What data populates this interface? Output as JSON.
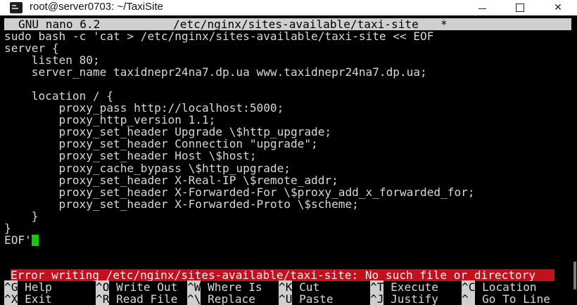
{
  "window": {
    "title": "root@server0703: ~/TaxiSite",
    "minimize_label": "",
    "maximize_label": "",
    "close_label": "✕"
  },
  "nano": {
    "version": "GNU nano 6.2",
    "filename": "/etc/nginx/sites-available/taxi-site",
    "modified": "*"
  },
  "code_lines": [
    "sudo bash -c 'cat > /etc/nginx/sites-available/taxi-site << EOF",
    "server {",
    "    listen 80;",
    "    server_name taxidnepr24na7.dp.ua www.taxidnepr24na7.dp.ua;",
    "",
    "    location / {",
    "        proxy_pass http://localhost:5000;",
    "        proxy_http_version 1.1;",
    "        proxy_set_header Upgrade \\$http_upgrade;",
    "        proxy_set_header Connection \"upgrade\";",
    "        proxy_set_header Host \\$host;",
    "        proxy_cache_bypass \\$http_upgrade;",
    "        proxy_set_header X-Real-IP \\$remote_addr;",
    "        proxy_set_header X-Forwarded-For \\$proxy_add_x_forwarded_for;",
    "        proxy_set_header X-Forwarded-Proto \\$scheme;",
    "    }",
    "}",
    "EOF'"
  ],
  "status": {
    "message": "Error writing /etc/nginx/sites-available/taxi-site: No such file or directory"
  },
  "shortcuts": {
    "row1": [
      {
        "key": "^G",
        "label": " Help"
      },
      {
        "key": "^O",
        "label": " Write Out"
      },
      {
        "key": "^W",
        "label": " Where Is"
      },
      {
        "key": "^K",
        "label": " Cut"
      },
      {
        "key": "^T",
        "label": " Execute"
      },
      {
        "key": "^C",
        "label": " Location"
      }
    ],
    "row2": [
      {
        "key": "^X",
        "label": " Exit"
      },
      {
        "key": "^R",
        "label": " Read File"
      },
      {
        "key": "^\\",
        "label": " Replace"
      },
      {
        "key": "^U",
        "label": " Paste"
      },
      {
        "key": "^J",
        "label": " Justify"
      },
      {
        "key": "^_",
        "label": " Go To Line"
      }
    ]
  },
  "colors": {
    "error_bg": "#c50f1f",
    "cursor": "#16c60c",
    "header_bg": "#cfcfcf"
  }
}
